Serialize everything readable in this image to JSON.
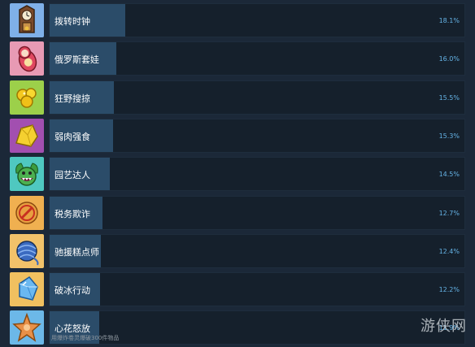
{
  "achievements": [
    {
      "name": "拨转时钟",
      "percent_label": "18.1%",
      "percent": 18.1,
      "icon": "grandfather-clock-icon",
      "bg": "#7fb0e8",
      "description": ""
    },
    {
      "name": "俄罗斯套娃",
      "percent_label": "16.0%",
      "percent": 16.0,
      "icon": "nesting-doll-icon",
      "bg": "#e89ab4",
      "description": ""
    },
    {
      "name": "狂野搜掠",
      "percent_label": "15.5%",
      "percent": 15.5,
      "icon": "gold-coins-icon",
      "bg": "#9cd04a",
      "description": ""
    },
    {
      "name": "弱肉强食",
      "percent_label": "15.3%",
      "percent": 15.3,
      "icon": "gold-nugget-icon",
      "bg": "#a24fb0",
      "description": ""
    },
    {
      "name": "园艺达人",
      "percent_label": "14.5%",
      "percent": 14.5,
      "icon": "plant-monster-icon",
      "bg": "#4fc8c0",
      "description": ""
    },
    {
      "name": "税务欺诈",
      "percent_label": "12.7%",
      "percent": 12.7,
      "icon": "tax-stamp-icon",
      "bg": "#f0b050",
      "description": ""
    },
    {
      "name": "驰援糕点师",
      "percent_label": "12.4%",
      "percent": 12.4,
      "icon": "yarn-ball-icon",
      "bg": "#f2c26a",
      "description": ""
    },
    {
      "name": "破冰行动",
      "percent_label": "12.2%",
      "percent": 12.2,
      "icon": "ice-crystal-icon",
      "bg": "#f0c060",
      "description": ""
    },
    {
      "name": "心花怒放",
      "percent_label": "11.9%",
      "percent": 11.9,
      "icon": "starfish-cookie-icon",
      "bg": "#6cb8e8",
      "description": "用爆炸卷灵爆破300件物品"
    }
  ],
  "watermark": "游侠网",
  "colors": {
    "page_bg": "#1b2838",
    "bar_bg": "#15202c",
    "bar_fill": "#2b4c69",
    "percent_text": "#65b3e6"
  }
}
